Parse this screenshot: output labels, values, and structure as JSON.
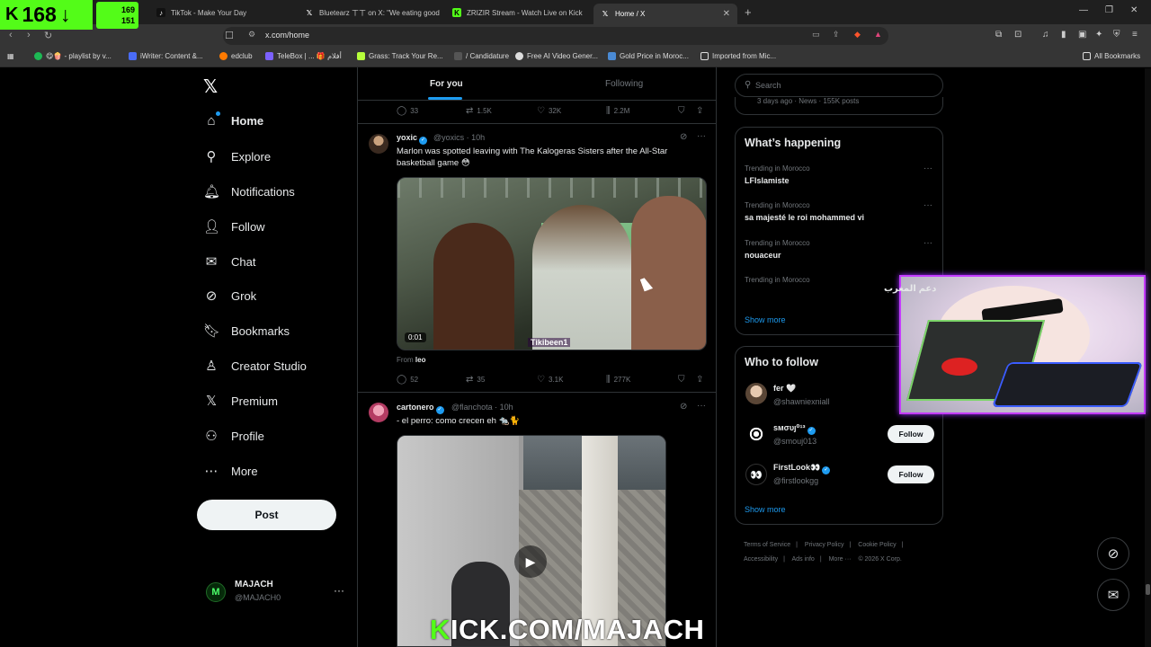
{
  "stream_badge": {
    "count": "168",
    "arrow": "↓",
    "stat_top": "169",
    "stat_bottom": "151"
  },
  "browser": {
    "tabs": [
      {
        "title": "TikTok - Make Your Day",
        "icon": "tiktok-icon",
        "color": "#111111"
      },
      {
        "title": "Bluetearz ㄒㄒ on X: \"We eating good",
        "icon": "x-icon",
        "color": "#111111"
      },
      {
        "title": "ZRIZIR Stream - Watch Live on Kick",
        "icon": "kick-icon",
        "color": "#53fc18"
      },
      {
        "title": "Home / X",
        "icon": "x-icon",
        "color": "#111111",
        "active": true
      }
    ],
    "url": "x.com/home",
    "bookmarks": [
      {
        "label": "😋🍿 - playlist by v...",
        "icon": "spotify-icon",
        "color": "#1db954"
      },
      {
        "label": "iWriter: Content &...",
        "icon": "iwriter-icon",
        "color": "#4a6cf7"
      },
      {
        "label": "edclub",
        "icon": "edclub-icon",
        "color": "#ff7a00"
      },
      {
        "label": "TeleBox | ... 🎁 أفلام",
        "icon": "telebox-icon",
        "color": "#7b61ff"
      },
      {
        "label": "Grass: Track Your Re...",
        "icon": "grass-icon",
        "color": "#b6ff3b"
      },
      {
        "label": "/ Candidature",
        "icon": "candidature-icon",
        "color": "#555555"
      },
      {
        "label": "Free AI Video Gener...",
        "icon": "ai-video-icon",
        "color": "#dddddd"
      },
      {
        "label": "Gold Price in Moroc...",
        "icon": "gold-price-icon",
        "color": "#4a8ad4"
      },
      {
        "label": "Imported from Mic...",
        "icon": "folder-icon",
        "color": "#dddddd"
      }
    ],
    "all_bookmarks": "All Bookmarks"
  },
  "sidebar": {
    "items": [
      {
        "label": "Home",
        "icon": "home-icon",
        "glyph": "⌂"
      },
      {
        "label": "Explore",
        "icon": "search-icon",
        "glyph": "⚲"
      },
      {
        "label": "Notifications",
        "icon": "bell-icon",
        "glyph": "🔔︎"
      },
      {
        "label": "Follow",
        "icon": "add-person-icon",
        "glyph": "👤︎"
      },
      {
        "label": "Chat",
        "icon": "mail-icon",
        "glyph": "✉"
      },
      {
        "label": "Grok",
        "icon": "grok-icon",
        "glyph": "⊘"
      },
      {
        "label": "Bookmarks",
        "icon": "bookmark-icon",
        "glyph": "🔖︎"
      },
      {
        "label": "Creator Studio",
        "icon": "creator-studio-icon",
        "glyph": "♙"
      },
      {
        "label": "Premium",
        "icon": "x-premium-icon",
        "glyph": "𝕏"
      },
      {
        "label": "Profile",
        "icon": "person-icon",
        "glyph": "⚇"
      },
      {
        "label": "More",
        "icon": "more-circle-icon",
        "glyph": "⋯"
      }
    ],
    "post_button": "Post",
    "account": {
      "name": "MAJACH",
      "handle": "@MAJACH0"
    }
  },
  "timeline": {
    "tabs": {
      "for_you": "For you",
      "following": "Following"
    },
    "prev_actions": {
      "replies": "33",
      "reposts": "1.5K",
      "likes": "32K",
      "views": "2.2M"
    },
    "tweets": [
      {
        "name": "yoxic",
        "handle": "@yoxics · 10h",
        "text": "Marlon was spotted leaving with The Kalogeras Sisters after the All-Star basketball game 😳",
        "video_time": "0:01",
        "watermark": "Tikibeen1",
        "from_label": "From",
        "from_user": "leo",
        "actions": {
          "replies": "52",
          "reposts": "35",
          "likes": "3.1K",
          "views": "277K"
        }
      },
      {
        "name": "cartonero",
        "handle": "@flanchota · 10h",
        "text": "- el perro: como crecen eh 🐀🐈"
      }
    ]
  },
  "right": {
    "search_placeholder": "Search",
    "prev_meta": "3 days ago · News · 155K posts",
    "whats_happening": {
      "title": "What’s happening",
      "trends": [
        {
          "meta": "Trending in Morocco",
          "name": "LFIslamiste"
        },
        {
          "meta": "Trending in Morocco",
          "name": "sa majesté le roi mohammed vi"
        },
        {
          "meta": "Trending in Morocco",
          "name": "nouaceur"
        },
        {
          "meta": "Trending in Morocco",
          "name": "دعم المغرب"
        }
      ],
      "show_more": "Show more"
    },
    "who_to_follow": {
      "title": "Who to follow",
      "users": [
        {
          "name": "fer 🤍",
          "handle": "@shawniexniall"
        },
        {
          "name": "sмσυȷ⁰¹³",
          "handle": "@smouj013",
          "button": "Follow"
        },
        {
          "name": "FirstLook👀",
          "handle": "@firstlookgg",
          "button": "Follow"
        }
      ],
      "show_more": "Show more"
    },
    "footer": [
      "Terms of Service",
      "|",
      "Privacy Policy",
      "|",
      "Cookie Policy",
      "|",
      "Accessibility",
      "|",
      "Ads info",
      "|",
      "More ···",
      "© 2026 X Corp."
    ]
  },
  "overlay": {
    "kick_prefix": "K",
    "kick_url": "ICK.COM/MAJACH"
  },
  "colors": {
    "accent": "#1d9bf0",
    "kick_green": "#53fc18",
    "background": "#000000"
  }
}
